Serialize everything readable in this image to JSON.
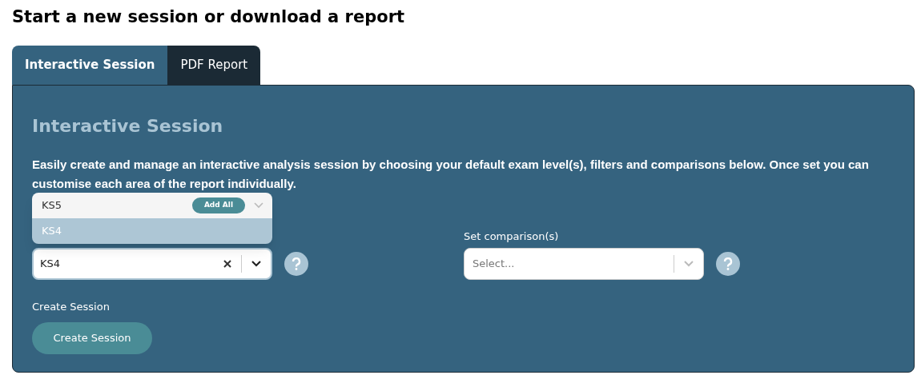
{
  "page_title": "Start a new session or download a report",
  "tabs": [
    {
      "label": "Interactive Session",
      "selected": true
    },
    {
      "label": "PDF Report",
      "selected": false
    }
  ],
  "panel": {
    "heading": "Interactive Session",
    "description": "Easily create and manage an interactive analysis session by choosing your default exam level(s), filters and comparisons below. Once set you can customise each area of the report individually.",
    "exam_level": {
      "value": "KS4",
      "expanded": true,
      "options": [
        {
          "label": "KS5",
          "selected": false
        },
        {
          "label": "KS4",
          "selected": true
        }
      ],
      "add_all": "Add All"
    },
    "comparison": {
      "label": "Set comparison(s)",
      "placeholder": "Select..."
    },
    "create": {
      "label": "Create Session",
      "button": "Create Session"
    }
  }
}
